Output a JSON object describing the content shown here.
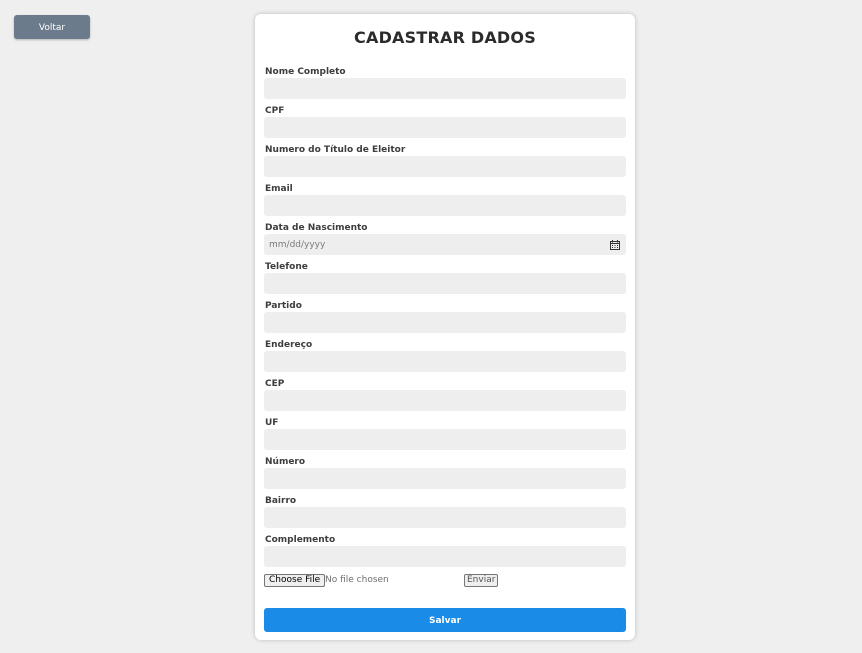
{
  "back_button": {
    "label": "Voltar"
  },
  "form": {
    "title": "CADASTRAR DADOS",
    "fields": [
      {
        "label": "Nome Completo",
        "value": ""
      },
      {
        "label": "CPF",
        "value": ""
      },
      {
        "label": "Numero do Título de Eleitor",
        "value": ""
      },
      {
        "label": "Email",
        "value": ""
      },
      {
        "label": "Data de Nascimento",
        "value": "",
        "placeholder": "mm/dd/yyyy"
      },
      {
        "label": "Telefone",
        "value": ""
      },
      {
        "label": "Partido",
        "value": ""
      },
      {
        "label": "Endereço",
        "value": ""
      },
      {
        "label": "CEP",
        "value": ""
      },
      {
        "label": "UF",
        "value": ""
      },
      {
        "label": "Número",
        "value": ""
      },
      {
        "label": "Bairro",
        "value": ""
      },
      {
        "label": "Complemento",
        "value": ""
      }
    ],
    "file": {
      "choose_label": "Choose File",
      "status": "No file chosen",
      "send_label": "Enviar"
    },
    "save_label": "Salvar"
  },
  "colors": {
    "page_background": "#efefef",
    "back_button": "#6c7b8b",
    "input_background": "#eeeeee",
    "save_button": "#1b8be8"
  },
  "icons": {
    "date_field": "calendar-icon"
  }
}
